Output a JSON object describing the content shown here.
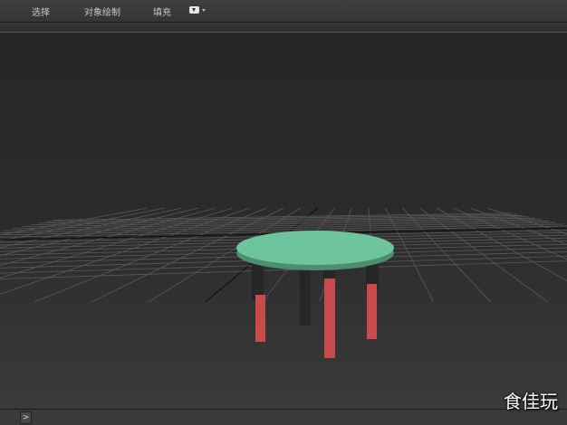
{
  "menu": {
    "items": [
      "选择",
      "对象绘制",
      "填充"
    ]
  },
  "dropdown": {
    "icon": "chevron-down-icon"
  },
  "bottombar": {
    "expand_label": ">"
  },
  "watermark": {
    "text": "食佳玩"
  },
  "scene": {
    "object": "round-table",
    "colors": {
      "tabletop": "#6ec49c",
      "tabletop_edge": "#4b8f70",
      "leg_red": "#c94a4c",
      "leg_dark": "#262626",
      "grid": "#5a5a5a",
      "grid_axis": "#111111"
    }
  }
}
